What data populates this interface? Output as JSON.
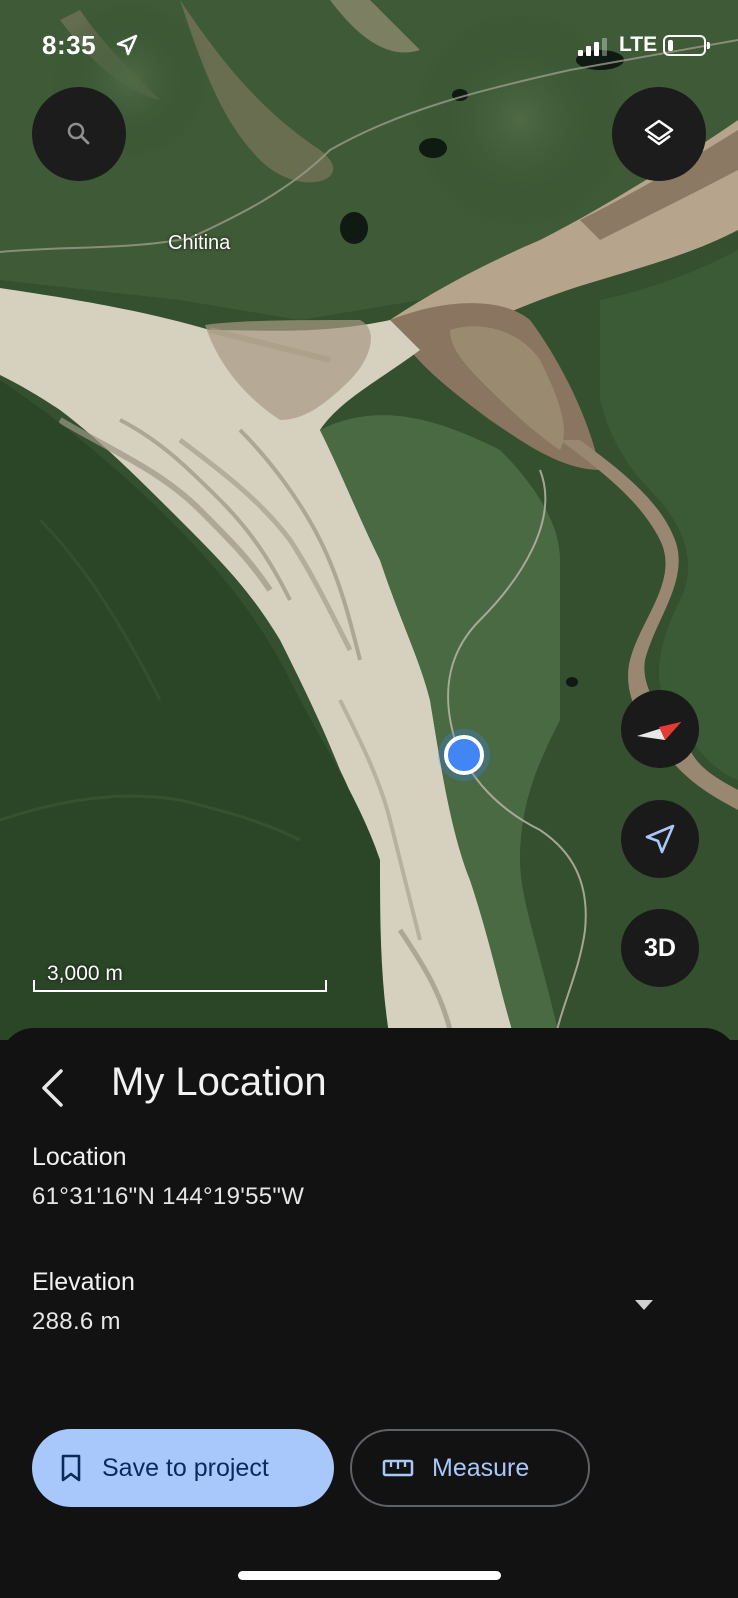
{
  "status": {
    "time": "8:35",
    "network": "LTE",
    "battery_percent": 15
  },
  "map": {
    "place_label": "Chitina",
    "scale_label": "3,000 m",
    "search_icon": "search-icon",
    "layers_icon": "layers-icon",
    "compass_icon": "compass-icon",
    "locate_icon": "navigation-arrow-icon",
    "view_3d_label": "3D",
    "location_dot_color": "#4285f4"
  },
  "sheet": {
    "back_icon": "chevron-left-icon",
    "title": "My Location",
    "location_label": "Location",
    "location_value": "61°31'16\"N 144°19'55\"W",
    "elevation_label": "Elevation",
    "elevation_value": "288.6 m",
    "expand_icon": "caret-down-icon",
    "save_button_label": "Save to project",
    "save_icon": "bookmark-icon",
    "measure_button_label": "Measure",
    "measure_icon": "ruler-icon",
    "accent_color": "#a8c7fa"
  }
}
